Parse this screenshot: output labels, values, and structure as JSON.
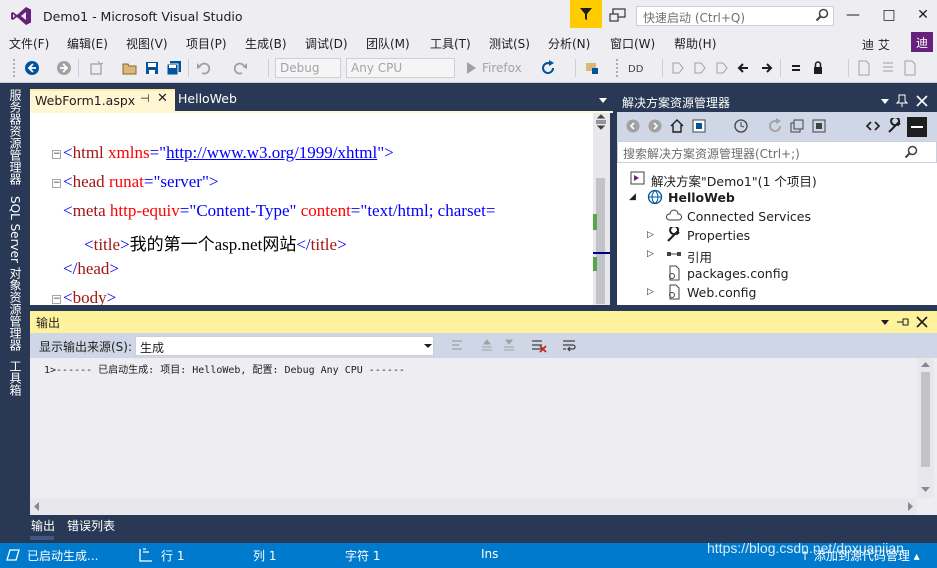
{
  "window": {
    "title": "Demo1 - Microsoft Visual Studio",
    "quick_launch_placeholder": "快速启动 (Ctrl+Q)",
    "minimize": "—",
    "maximize": "□",
    "close": "✕"
  },
  "menu": {
    "items": [
      "文件(F)",
      "编辑(E)",
      "视图(V)",
      "项目(P)",
      "生成(B)",
      "调试(D)",
      "团队(M)",
      "工具(T)",
      "测试(S)",
      "分析(N)",
      "窗口(W)",
      "帮助(H)"
    ],
    "user_name": "迪 艾",
    "user_avatar": "迪"
  },
  "toolbar": {
    "config": "Debug",
    "platform": "Any CPU",
    "browser": "Firefox"
  },
  "left_tabs": [
    "服务器资源管理器",
    "SQL Server 对象资源管理器",
    "工具箱"
  ],
  "editor": {
    "tabs": [
      {
        "label": "WebForm1.aspx",
        "pin": "⊣",
        "close": "✕"
      },
      {
        "label": "HelloWeb"
      }
    ],
    "lines": {
      "l1_b1": "<",
      "l1_tag": "html",
      "l1_attr": " xmlns",
      "l1_eq": "=\"",
      "l1_val": "http://www.w3.org/1999/xhtml",
      "l1_end": "\">",
      "l2_b1": "<",
      "l2_tag": "head",
      "l2_attr": " runat",
      "l2_eq": "=\"",
      "l2_val": "server",
      "l2_end": "\">",
      "l3_b1": "<",
      "l3_tag": "meta",
      "l3_attr": " http-equiv",
      "l3_eq": "=\"",
      "l3_val": "Content-Type",
      "l3_q": "\"",
      "l3_attr2": " content",
      "l3_eq2": "=\"",
      "l3_val2": "text/html; charset=",
      "l4_b1": "<",
      "l4_tag": "title",
      "l4_b2": ">",
      "l4_text": "我的第一个asp.net网站",
      "l4_b3": "</",
      "l4_tag2": "title",
      "l4_b4": ">",
      "l5_b1": "</",
      "l5_tag": "head",
      "l5_b2": ">",
      "l6_b1": "<",
      "l6_tag": "body",
      "l6_b2": ">"
    }
  },
  "solution_explorer": {
    "title": "解决方案资源管理器",
    "search_placeholder": "搜索解决方案资源管理器(Ctrl+;)",
    "solution": "解决方案\"Demo1\"(1 个项目)",
    "project": "HelloWeb",
    "items": [
      "Connected Services",
      "Properties",
      "引用",
      "packages.config",
      "Web.config"
    ]
  },
  "output": {
    "title": "输出",
    "source_label": "显示输出来源(S):",
    "source_value": "生成",
    "text": "1>------ 已启动生成: 项目: HelloWeb, 配置: Debug Any CPU ------"
  },
  "bottom_tabs": [
    "输出",
    "错误列表"
  ],
  "status": {
    "message": "已启动生成...",
    "line": "行 1",
    "col": "列 1",
    "char": "字符 1",
    "mode": "Ins",
    "source_control": "↑ 添加到源代码管理 ▴"
  },
  "watermark": "https://blog.csdn.net/dpxuanjian",
  "colors": {
    "accent": "#007acc",
    "frame": "#293955",
    "active_tab": "#fff6d4",
    "output_header": "#fff29d",
    "notify": "#ffcc00"
  }
}
